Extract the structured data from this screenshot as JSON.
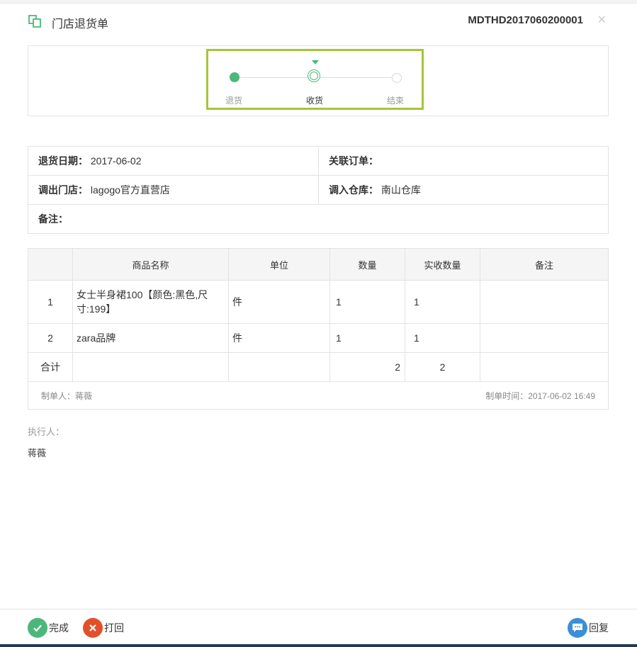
{
  "header": {
    "title": "门店退货单",
    "doc_no": "MDTHD2017060200001",
    "close_label": "×"
  },
  "steps": [
    {
      "label": "退货",
      "state": "done"
    },
    {
      "label": "收货",
      "state": "current"
    },
    {
      "label": "结束",
      "state": "todo"
    }
  ],
  "info": {
    "return_date_label": "退货日期：",
    "return_date": "2017-06-02",
    "related_order_label": "关联订单：",
    "related_order": "",
    "out_store_label": "调出门店：",
    "out_store": "lagogo官方直营店",
    "in_warehouse_label": "调入仓库：",
    "in_warehouse": "南山仓库",
    "remark_label": "备注：",
    "remark": ""
  },
  "table": {
    "headers": [
      "",
      "商品名称",
      "单位",
      "数量",
      "实收数量",
      "备注"
    ],
    "rows": [
      {
        "idx": "1",
        "name": "女士半身裙100【颜色:黑色,尺寸:199】",
        "unit": "件",
        "qty": "1",
        "received": "1",
        "remark": ""
      },
      {
        "idx": "2",
        "name": "zara品牌",
        "unit": "件",
        "qty": "1",
        "received": "1",
        "remark": ""
      }
    ],
    "total": {
      "label": "合计",
      "qty": "2",
      "received": "2"
    },
    "creator": "制单人：蒋薇",
    "created_time": "制单时间：2017-06-02 16:49"
  },
  "executor": {
    "label": "执行人：",
    "name": "蒋薇"
  },
  "actions": {
    "finish": "完成",
    "reject": "打回",
    "reply": "回复"
  },
  "colors": {
    "accent": "#4cb77a",
    "highlight_frame": "#a4c639",
    "reject": "#e2502b",
    "reply": "#3d8ed8"
  },
  "icons": [
    "document-copy-icon",
    "close-icon",
    "check-icon",
    "x-icon",
    "chat-icon"
  ]
}
